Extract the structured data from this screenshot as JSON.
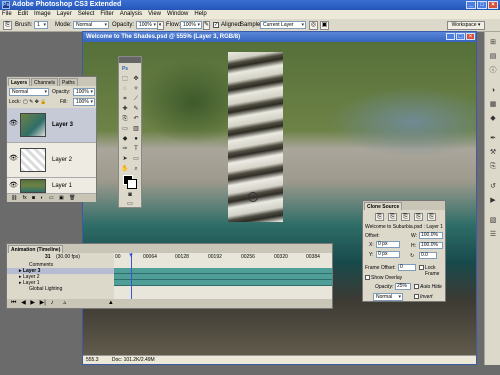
{
  "app": {
    "title": "Adobe Photoshop CS3 Extended"
  },
  "menu": [
    "File",
    "Edit",
    "Image",
    "Layer",
    "Select",
    "Filter",
    "Analysis",
    "View",
    "Window",
    "Help"
  ],
  "options": {
    "brush_label": "Brush:",
    "brush_size": "1",
    "mode_label": "Mode:",
    "mode_value": "Normal",
    "opacity_label": "Opacity:",
    "opacity_value": "100%",
    "flow_label": "Flow:",
    "flow_value": "100%",
    "aligned_label": "Aligned",
    "sample_label": "Sample:",
    "sample_value": "Current Layer",
    "workspace_label": "Workspace ▾"
  },
  "document": {
    "title": "Welcome to The Shades.psd @ 555% (Layer 3, RGB/8)",
    "zoom": "555.3",
    "doc_info": "Doc: 101.2K/2.49M"
  },
  "layers_panel": {
    "tabs": [
      "Layers",
      "Channels",
      "Paths"
    ],
    "blend_mode": "Normal",
    "opacity_label": "Opacity:",
    "opacity_value": "100%",
    "lock_label": "Lock:",
    "fill_label": "Fill:",
    "fill_value": "100%",
    "layers": [
      {
        "name": "Layer 3",
        "selected": true
      },
      {
        "name": "Layer 2",
        "selected": false
      },
      {
        "name": "Layer 1",
        "selected": false
      }
    ]
  },
  "animation_panel": {
    "tabs": [
      "Animation (Timeline)"
    ],
    "current_frame": "31",
    "fps": "(30.00 fps)",
    "ticks": [
      "00",
      "00064",
      "00128",
      "00192",
      "00256",
      "00320",
      "00384"
    ],
    "tracks": [
      "Comments",
      "Layer 3",
      "Layer 2",
      "Layer 1",
      "Global Lighting"
    ]
  },
  "clone_source": {
    "tab": "Clone Source",
    "source_name": "Welcome to Suburbia.psd : Layer 1",
    "offset_label": "Offset:",
    "x_label": "X:",
    "x_value": "0 px",
    "y_label": "Y:",
    "y_value": "0 px",
    "w_label": "W:",
    "w_value": "100.0%",
    "h_label": "H:",
    "h_value": "100.0%",
    "angle_value": "0.0",
    "frame_offset_label": "Frame Offset:",
    "frame_offset_value": "0",
    "lock_frame_label": "Lock Frame",
    "show_overlay_label": "Show Overlay",
    "overlay_opacity_label": "Opacity:",
    "overlay_opacity_value": "25%",
    "auto_hide_label": "Auto Hide",
    "overlay_mode": "Normal",
    "invert_label": "Invert"
  }
}
